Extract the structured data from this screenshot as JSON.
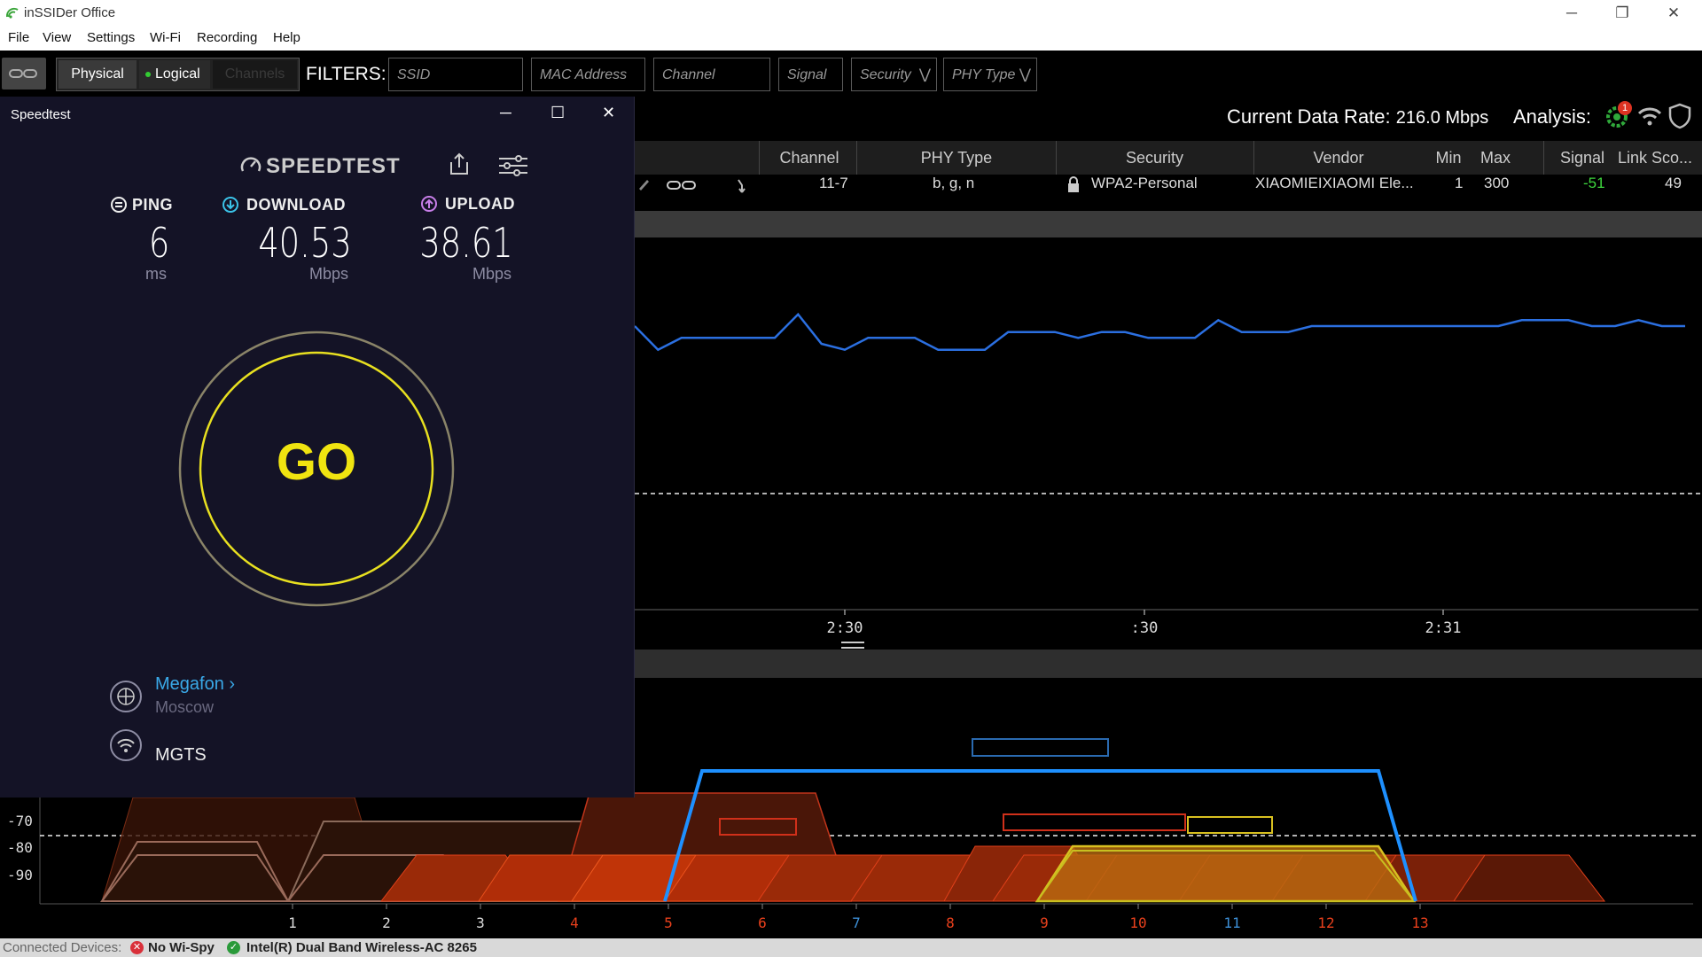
{
  "app": {
    "title": "inSSIDer Office"
  },
  "menu": [
    "File",
    "View",
    "Settings",
    "Wi-Fi",
    "Recording",
    "Help"
  ],
  "toolbar": {
    "physical": "Physical",
    "logical": "Logical",
    "channels": "Channels",
    "filters_label": "FILTERS:",
    "filters": {
      "ssid": "SSID",
      "mac": "MAC Address",
      "channel": "Channel",
      "signal": "Signal",
      "security": "Security",
      "phy": "PHY Type"
    }
  },
  "status_bar": {
    "data_rate_label": "Current Data Rate:",
    "data_rate_value": "216.0 Mbps",
    "analysis_label": "Analysis:",
    "analysis_badge": "1"
  },
  "table": {
    "columns": [
      "Channel",
      "PHY Type",
      "Security",
      "Vendor",
      "Min",
      "Max",
      "Signal",
      "Link Sco..."
    ],
    "row": {
      "channel": "11-7",
      "phy": "b, g, n",
      "security": "WPA2-Personal",
      "vendor": "XIAOMIEIXIAOMI Ele...",
      "min": "1",
      "max": "300",
      "signal": "-51",
      "link_score": "49"
    }
  },
  "time_graph": {
    "x_ticks": [
      "2:30",
      ":30",
      "2:31"
    ],
    "signal_series": [
      -51,
      -55,
      -53,
      -53,
      -53,
      -53,
      -53,
      -49,
      -54,
      -55,
      -53,
      -53,
      -53,
      -55,
      -55,
      -55,
      -52,
      -52,
      -52,
      -53,
      -52,
      -52,
      -53,
      -53,
      -53,
      -50,
      -52,
      -52,
      -52,
      -51,
      -51,
      -51,
      -51,
      -51,
      -51,
      -51,
      -51,
      -51,
      -50,
      -50,
      -50,
      -51,
      -51,
      -50,
      -51,
      -51
    ]
  },
  "channel_graph": {
    "y_ticks": [
      "-70",
      "-80",
      "-90"
    ],
    "channels": [
      "1",
      "2",
      "3",
      "4",
      "5",
      "6",
      "7",
      "8",
      "9",
      "10",
      "11",
      "12",
      "13"
    ],
    "channel_colors": [
      "#ddd",
      "#ddd",
      "#ddd",
      "#e8401c",
      "#e8401c",
      "#e8401c",
      "#3d8fd6",
      "#e8401c",
      "#e8401c",
      "#e8401c",
      "#3d8fd6",
      "#e8401c",
      "#e8401c"
    ]
  },
  "speedtest": {
    "window_title": "Speedtest",
    "brand": "SPEEDTEST",
    "ping": {
      "label": "PING",
      "value": "6",
      "unit": "ms"
    },
    "download": {
      "label": "DOWNLOAD",
      "value": "40.53",
      "unit": "Mbps"
    },
    "upload": {
      "label": "UPLOAD",
      "value": "38.61",
      "unit": "Mbps"
    },
    "go": "GO",
    "server": "Megafon",
    "server_chevron": "›",
    "location": "Moscow",
    "isp": "MGTS"
  },
  "footer": {
    "label": "Connected Devices:",
    "dev1": "No Wi-Spy",
    "dev2": "Intel(R) Dual Band Wireless-AC 8265"
  }
}
